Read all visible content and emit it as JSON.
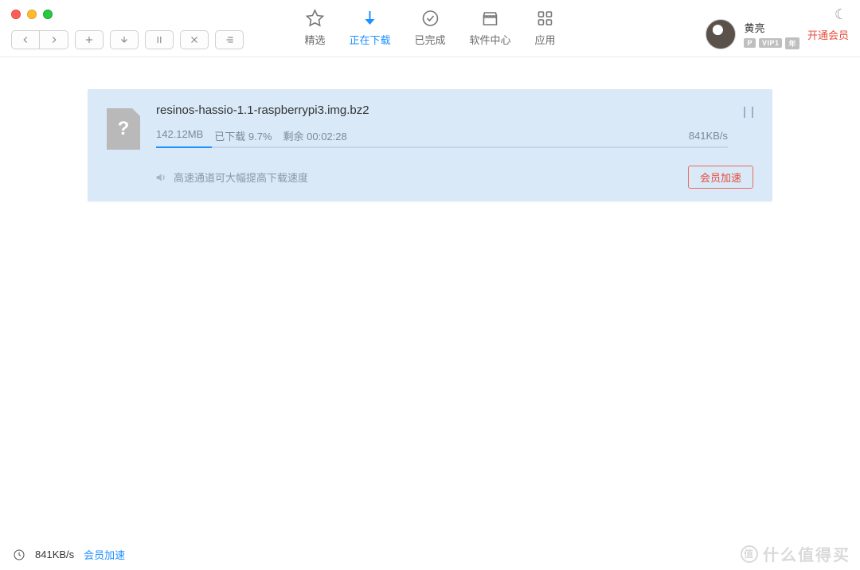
{
  "tabs": {
    "featured": "精选",
    "downloading": "正在下载",
    "completed": "已完成",
    "software": "软件中心",
    "apps": "应用"
  },
  "user": {
    "name": "黄亮",
    "badge_p": "P",
    "badge_vip": "VIP1",
    "badge_year": "年",
    "open_vip": "开通会员"
  },
  "download": {
    "filename": "resinos-hassio-1.1-raspberrypi3.img.bz2",
    "size": "142.12MB",
    "progress_label": "已下载 9.7%",
    "remaining_label": "剩余 00:02:28",
    "speed": "841KB/s",
    "promo_text": "高速通道可大幅提高下载速度",
    "accel_button": "会员加速"
  },
  "footer": {
    "speed": "841KB/s",
    "accel_link": "会员加速"
  },
  "watermark": {
    "brand": "值",
    "text": "什么值得买"
  }
}
